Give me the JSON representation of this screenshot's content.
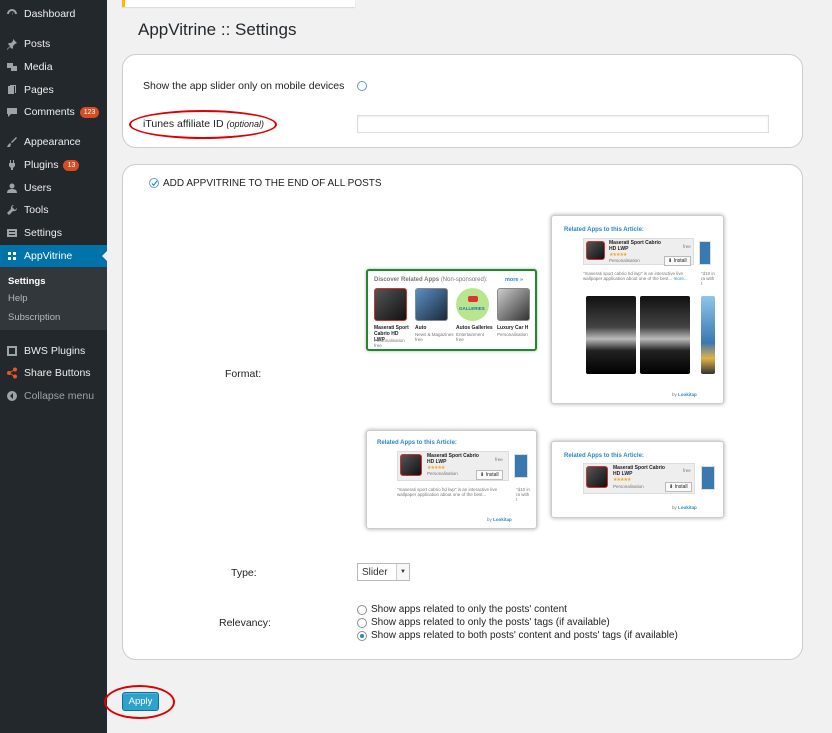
{
  "sidebar": {
    "items": [
      {
        "label": "Dashboard",
        "icon": "dashboard-icon"
      },
      {
        "label": "Posts",
        "icon": "pin-icon"
      },
      {
        "label": "Media",
        "icon": "media-icon"
      },
      {
        "label": "Pages",
        "icon": "pages-icon"
      },
      {
        "label": "Comments",
        "icon": "comment-icon",
        "badge": "123"
      },
      {
        "label": "Appearance",
        "icon": "brush-icon"
      },
      {
        "label": "Plugins",
        "icon": "plug-icon",
        "badge": "13"
      },
      {
        "label": "Users",
        "icon": "user-icon"
      },
      {
        "label": "Tools",
        "icon": "wrench-icon"
      },
      {
        "label": "Settings",
        "icon": "settings-icon"
      },
      {
        "label": "AppVitrine",
        "icon": "appvitrine-icon",
        "active": true
      },
      {
        "label": "BWS Plugins",
        "icon": "bws-icon"
      },
      {
        "label": "Share Buttons",
        "icon": "share-icon"
      },
      {
        "label": "Collapse menu",
        "icon": "collapse-icon"
      }
    ],
    "submenu": [
      "Settings",
      "Help",
      "Subscription"
    ]
  },
  "page": {
    "title": "AppVitrine :: Settings"
  },
  "panel1": {
    "mobile_label": "Show the app slider only on mobile devices",
    "itunes_label": "iTunes affiliate ID",
    "itunes_optional": "(optional)",
    "itunes_value": ""
  },
  "panel2": {
    "add_label": "ADD APPVITRINE TO THE END OF ALL POSTS",
    "format_label": "Format:",
    "type_label": "Type:",
    "type_value": "Slider",
    "relevancy_label": "Relevancy:",
    "relevancy_options": [
      "Show apps related to only the posts' content",
      "Show apps related to only the posts' tags (if available)",
      "Show apps related to both posts' content and posts' tags (if available)"
    ],
    "relevancy_selected": 2
  },
  "thumbs": {
    "discover_title": "Discover Related Apps",
    "discover_sub": "(Non-sponsored):",
    "more": "more »",
    "related_title": "Related Apps to this Article:",
    "app_name": "Maserati Sport Cabrio HD LWP",
    "app_cat": "Personalisation",
    "app_price": "free",
    "install": "Install",
    "desc": "\"maserati sport cabrio hd lwp\" is an interactive live wallpaper application about one of the best...",
    "desc_more": "more...",
    "by": "by",
    "brand": "Lookitap",
    "grid_apps": [
      {
        "name": "Maserati Sport Cabrio HD LWP",
        "cat": "Personalisation",
        "price": "free"
      },
      {
        "name": "Auto",
        "cat": "News & Magazines",
        "price": "free"
      },
      {
        "name": "Autos Galleries",
        "cat": "Entertainment",
        "price": "free"
      },
      {
        "name": "Luxury Car H",
        "cat": "Personalisation",
        "price": ""
      }
    ],
    "galleries": "GALLERIES",
    "side_text": "\"d10 in ra with t"
  },
  "actions": {
    "apply": "Apply"
  },
  "colors": {
    "sidebar_bg": "#23282d",
    "active_bg": "#0073aa",
    "highlight_oval": "#dd0000",
    "selected_border": "#1e8a2e",
    "apply_bg": "#2ea2cc"
  }
}
